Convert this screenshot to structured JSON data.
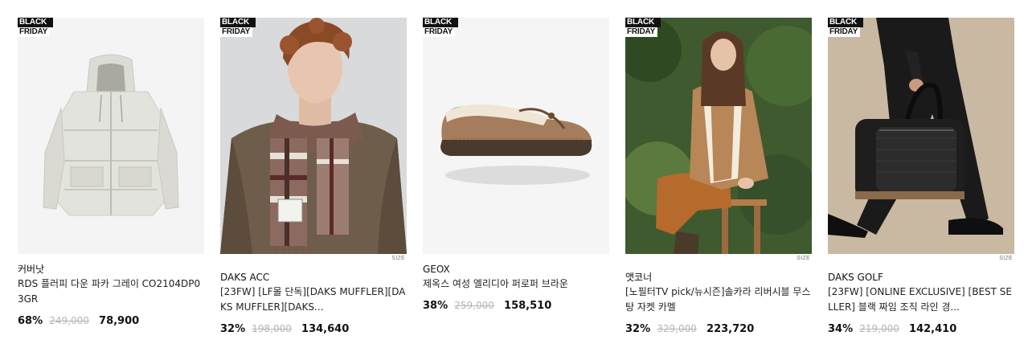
{
  "badge": {
    "line1": "BLACK",
    "line2": "FRIDAY"
  },
  "size_label": "SIZE",
  "products": [
    {
      "brand": "커버낫",
      "name": "RDS 플러피 다운 파카 그레이 CO2104DP03GR",
      "discount": "68%",
      "original_price": "249,000",
      "sale_price": "78,900"
    },
    {
      "brand": "DAKS ACC",
      "name": "[23FW] [LF몰 단독][DAKS MUFFLER][DAKS MUFFLER][DAKS...",
      "discount": "32%",
      "original_price": "198,000",
      "sale_price": "134,640"
    },
    {
      "brand": "GEOX",
      "name": "제옥스 여성 엘리디아 퍼로퍼 브라운",
      "discount": "38%",
      "original_price": "259,000",
      "sale_price": "158,510"
    },
    {
      "brand": "앳코너",
      "name": "[노필터TV pick/뉴시즌]솔카라 리버시블 무스탕 자켓 카멜",
      "discount": "32%",
      "original_price": "329,000",
      "sale_price": "223,720"
    },
    {
      "brand": "DAKS GOLF",
      "name": "[23FW] [ONLINE EXCLUSIVE] [BEST SELLER] 블랙 짜임 조직 라인 경...",
      "discount": "34%",
      "original_price": "219,000",
      "sale_price": "142,410"
    }
  ]
}
